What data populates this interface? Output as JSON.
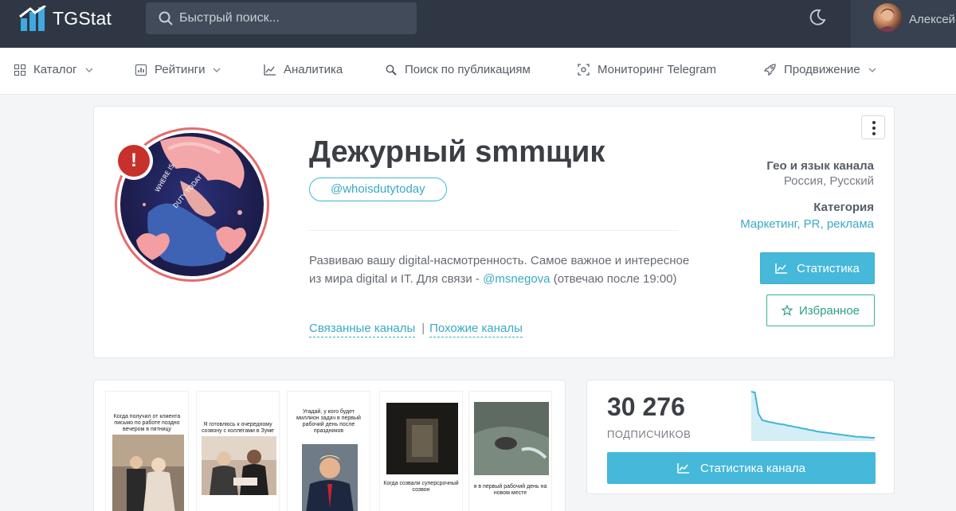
{
  "header": {
    "logo_text": "TGStat",
    "search_placeholder": "Быстрый поиск...",
    "user_name": "Алексей"
  },
  "nav": {
    "items": [
      {
        "label": "Каталог",
        "icon": "grid-icon",
        "dropdown": true
      },
      {
        "label": "Рейтинги",
        "icon": "bar-chart-icon",
        "dropdown": true
      },
      {
        "label": "Аналитика",
        "icon": "line-chart-icon",
        "dropdown": false
      },
      {
        "label": "Поиск по публикациям",
        "icon": "search-icon",
        "dropdown": false
      },
      {
        "label": "Мониторинг Telegram",
        "icon": "scan-icon",
        "dropdown": false
      },
      {
        "label": "Продвижение",
        "icon": "rocket-icon",
        "dropdown": true
      }
    ]
  },
  "channel": {
    "title": "Дежурный smmщик",
    "handle": "@whoisdutytoday",
    "description_before": "Развиваю вашу digital-насмотренность. Самое важное и интересное из мира digital и IT. Для связи - ",
    "description_link": "@msnegova",
    "description_after": " (отвечаю после 19:00)",
    "related_link": "Связанные каналы",
    "separator": "|",
    "similar_link": "Похожие каналы",
    "alert_mark": "!",
    "geo_label": "Гео и язык канала",
    "geo_value": "Россия, Русский",
    "category_label": "Категория",
    "category_value": "Маркетинг, PR, реклама",
    "stats_button": "Статистика",
    "favorite_button": "Избранное"
  },
  "posts": [
    {
      "caption": "Когда получил от клиента письмо по работе поздно вечером в пятницу"
    },
    {
      "caption": "Я готовлюсь к очередному созвону с коллегами в Зуме"
    },
    {
      "caption": "Угадай, у кого будет миллион задач в первый рабочий день после праздников"
    },
    {
      "caption": "Когда созвали суперсрочный созвон"
    },
    {
      "caption": "я в первый рабочий день на новом месте"
    }
  ],
  "subscribers": {
    "count": "30 276",
    "label": "ПОДПИСЧИКОВ",
    "channel_stats_button": "Статистика канала",
    "trend": [
      100,
      98,
      55,
      42,
      40,
      38,
      37,
      35,
      34,
      33,
      31,
      30,
      28,
      27,
      25,
      24,
      22,
      21,
      19,
      18,
      17,
      16,
      15,
      14,
      13,
      12,
      11,
      10,
      9,
      8,
      8,
      7,
      7,
      6,
      6
    ]
  },
  "colors": {
    "topbar": "#2f3744",
    "accent": "#46b8da",
    "favorite": "#35b596",
    "alert": "#c8302b"
  }
}
